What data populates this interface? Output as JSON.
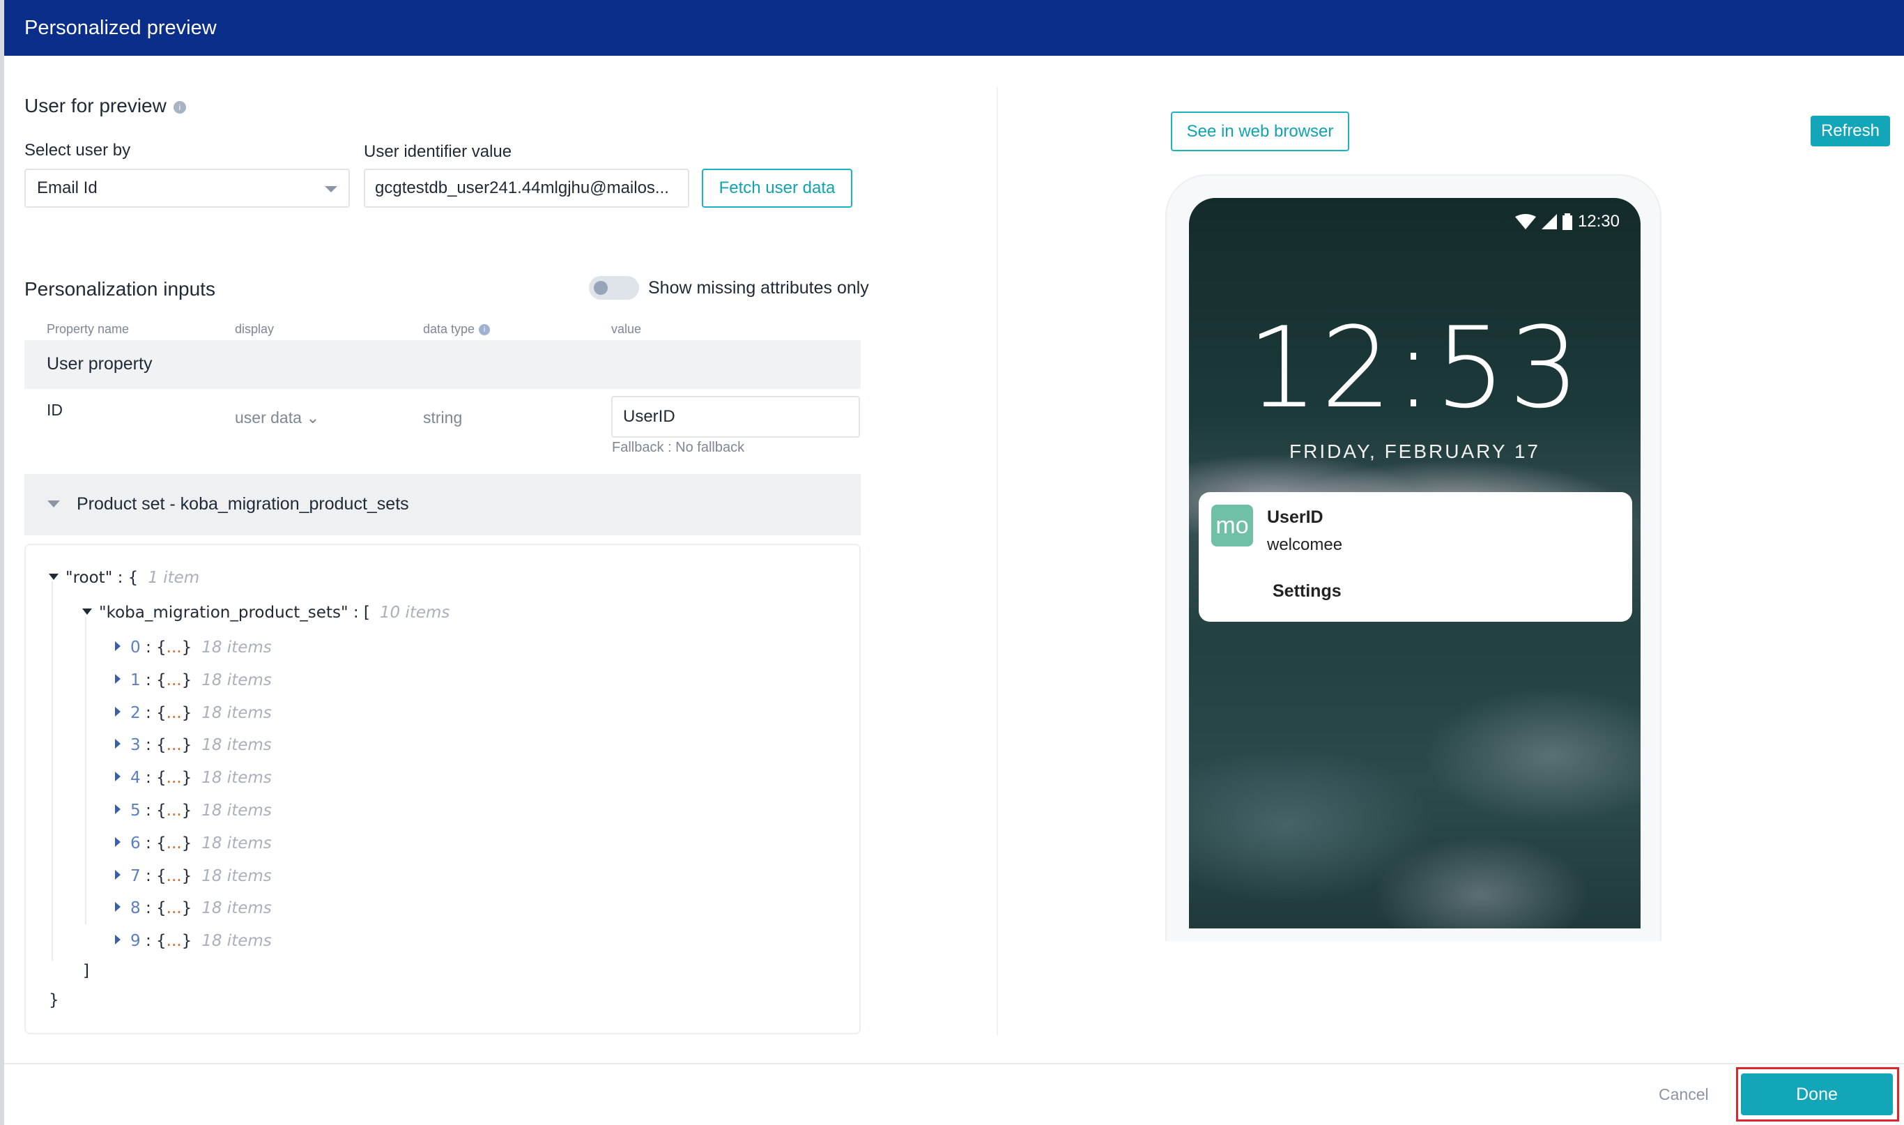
{
  "header": {
    "title": "Personalized preview"
  },
  "user_preview": {
    "title": "User for preview",
    "info_icon": "info-icon",
    "select_label": "Select user by",
    "select_value": "Email Id",
    "identifier_label": "User identifier value",
    "identifier_value": "gcgtestdb_user241.44mlgjhu@mailos...",
    "fetch_button": "Fetch user data"
  },
  "personalization": {
    "title": "Personalization inputs",
    "toggle_label": "Show missing attributes only",
    "toggle_on": false,
    "columns": [
      "Property name",
      "display",
      "data type",
      "value"
    ],
    "group": "User property",
    "row": {
      "name": "ID",
      "display": "user data",
      "type": "string",
      "value": "UserID",
      "fallback": "Fallback : No fallback"
    },
    "product_set": "Product set - koba_migration_product_sets"
  },
  "json_tree": {
    "root_key": "\"root\"",
    "root_count": "1 item",
    "child_key": "\"koba_migration_product_sets\"",
    "child_count": "10 items",
    "items": [
      {
        "index": "0",
        "count": "18 items"
      },
      {
        "index": "1",
        "count": "18 items"
      },
      {
        "index": "2",
        "count": "18 items"
      },
      {
        "index": "3",
        "count": "18 items"
      },
      {
        "index": "4",
        "count": "18 items"
      },
      {
        "index": "5",
        "count": "18 items"
      },
      {
        "index": "6",
        "count": "18 items"
      },
      {
        "index": "7",
        "count": "18 items"
      },
      {
        "index": "8",
        "count": "18 items"
      },
      {
        "index": "9",
        "count": "18 items"
      }
    ]
  },
  "preview": {
    "web_button": "See in web browser",
    "refresh_button": "Refresh",
    "status_time": "12:30",
    "clock": "12:53",
    "date": "FRIDAY, FEBRUARY 17",
    "notification": {
      "logo": "mo",
      "title": "UserID",
      "body": "welcomee",
      "settings": "Settings"
    }
  },
  "footer": {
    "cancel": "Cancel",
    "done": "Done"
  },
  "colors": {
    "header": "#0b2e8a",
    "accent": "#13a6b8",
    "highlight": "#e0242c"
  }
}
